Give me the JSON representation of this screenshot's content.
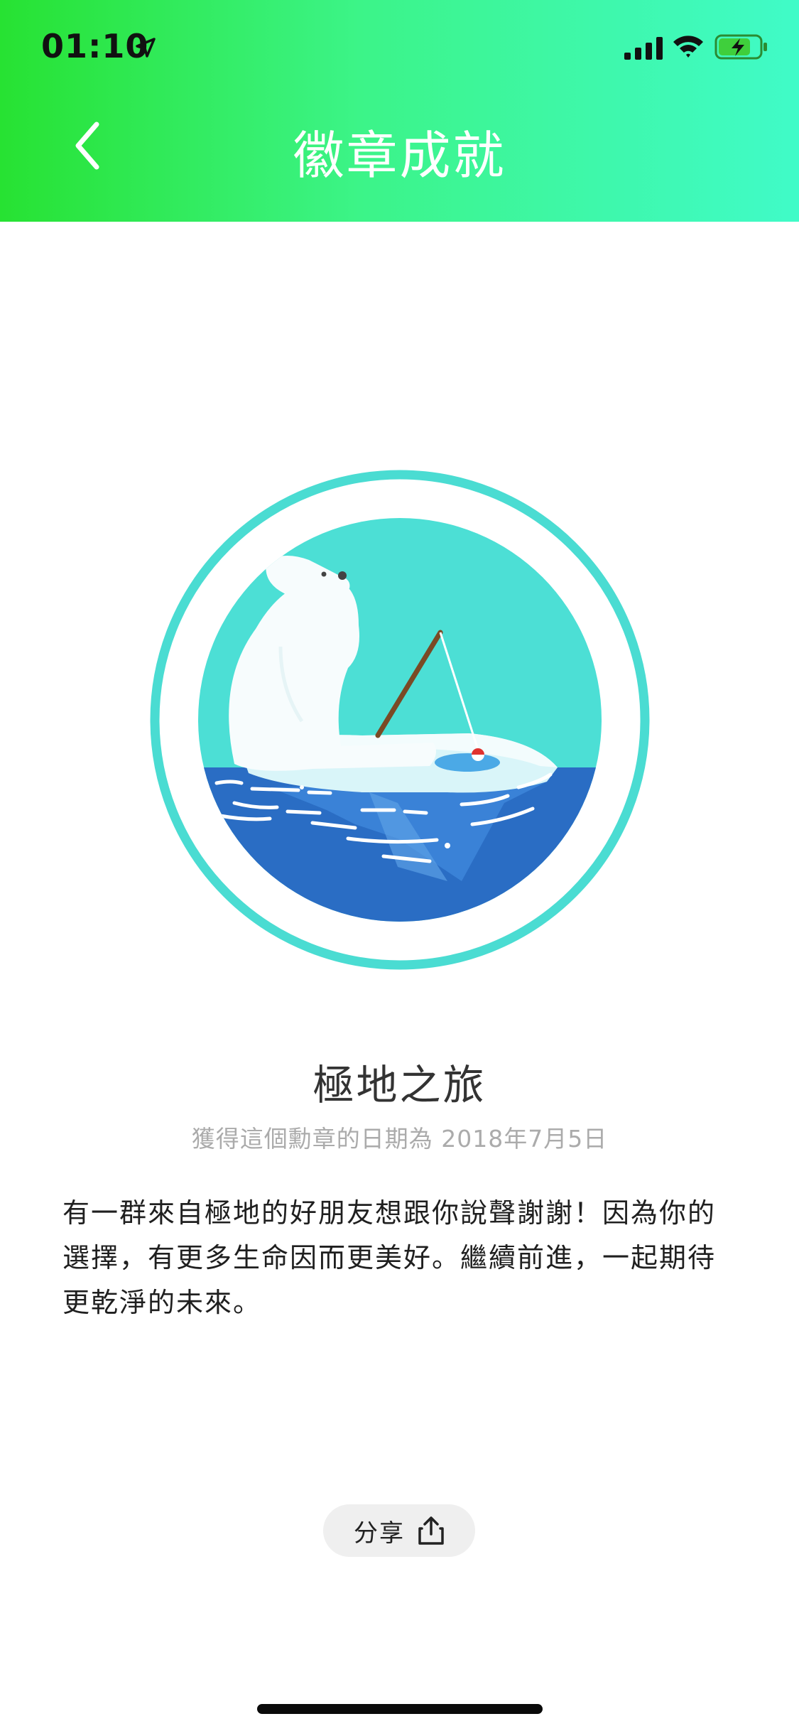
{
  "status_bar": {
    "time": "01:10",
    "icons": [
      "location-arrow-icon",
      "signal-bars-icon",
      "wifi-icon",
      "battery-charging-icon"
    ]
  },
  "header": {
    "title": "徽章成就",
    "back_icon": "chevron-left-icon",
    "gradient_colors": [
      "#27e232",
      "#40fbc8"
    ]
  },
  "badge": {
    "image_description_icon": "polar-bear-fishing-badge",
    "ring_color": "#4adcd2",
    "sky_color": "#4cdfd5",
    "sea_color": "#2a6dc4",
    "name": "極地之旅",
    "earned_date_text": "獲得這個勳章的日期為 2018年7月5日",
    "description": "有一群來自極地的好朋友想跟你說聲謝謝！因為你的選擇，有更多生命因而更美好。繼續前進，一起期待更乾淨的未來。"
  },
  "share": {
    "label": "分享",
    "icon": "share-upload-icon"
  }
}
